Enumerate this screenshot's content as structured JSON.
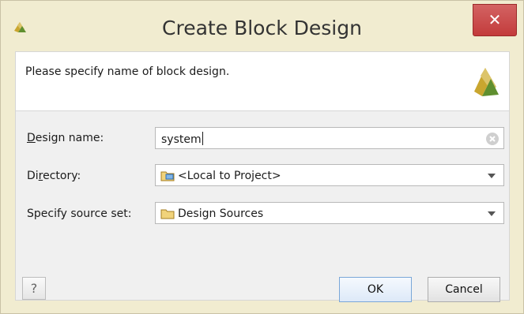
{
  "window": {
    "title": "Create Block Design",
    "close_glyph": "✕"
  },
  "banner": {
    "text": "Please specify name of block design."
  },
  "form": {
    "design_name": {
      "label_mnemonic": "D",
      "label_rest": "esign name:",
      "value": "system"
    },
    "directory": {
      "label_before": "Di",
      "label_mnemonic": "r",
      "label_rest": "ectory:",
      "value": "<Local to Project>",
      "icon": "folder-icon"
    },
    "source_set": {
      "label": "Specify source set:",
      "value": "Design Sources",
      "icon": "folder-icon"
    }
  },
  "buttons": {
    "help": "?",
    "ok": "OK",
    "cancel": "Cancel"
  },
  "colors": {
    "title_bar": "#f1ecd0",
    "close_button": "#c33b3b",
    "logo_yellow": "#c9a62f",
    "logo_green": "#5f8f2f"
  }
}
